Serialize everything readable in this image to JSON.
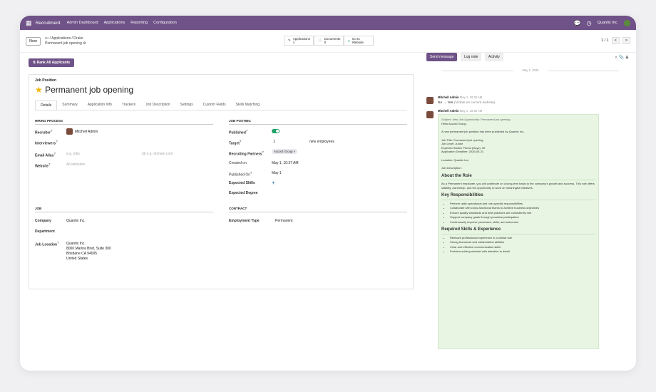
{
  "topbar": {
    "app_name": "Recruitment",
    "menus": [
      "Admin Dashboard",
      "Applications",
      "Reporting",
      "Configuration"
    ],
    "company": "Quantix Inc."
  },
  "subbar": {
    "new_label": "New",
    "breadcrumb": "••• / Applications / Drake",
    "current": "Permanent job opening",
    "smart_buttons": [
      {
        "label": "Applications",
        "count": "1"
      },
      {
        "label": "Documents",
        "count": "0"
      },
      {
        "label": "Go to",
        "count": "Website"
      }
    ],
    "pager": "1 / 1"
  },
  "form": {
    "rank_label": "Rank All Applicants",
    "job_position_label": "Job Position",
    "title": "Permanent job opening",
    "tabs": [
      "Details",
      "Summary",
      "Application Info",
      "Trackers",
      "Job Description",
      "Settings",
      "Custom Fields",
      "Skills Matching"
    ],
    "hiring_process": "HIRING PROCESS",
    "recruiter_label": "Recruiter",
    "recruiter": "Mitchell Admin",
    "interviewers_label": "Interviewers",
    "email_alias_label": "Email Alias",
    "email_ph": "e.g. jobs",
    "domain_ph": "@ e.g. domain.com",
    "website_label": "Website",
    "website_ph": "All websites",
    "job_posting": "JOB POSTING",
    "published_label": "Published",
    "target_label": "Target",
    "target": "1",
    "target_unit": "new employees",
    "partners_label": "Recruiting Partners",
    "partner_tag": "Accord Group ×",
    "created_label": "Created on",
    "created": "May 1, 10:37 AM",
    "published_on_label": "Published On",
    "published_on": "May 1",
    "skills_label": "Expected Skills",
    "degree_label": "Expected Degree",
    "job_section": "JOB",
    "company_label": "Company",
    "company": "Quantix Inc.",
    "department_label": "Department",
    "location_label": "Job Location",
    "location_lines": [
      "Quantix Inc.",
      "8000 Marina Blvd, Suite 300",
      "Brisbane CA 94005",
      "United States"
    ],
    "contract_section": "CONTRACT",
    "employment_label": "Employment Type",
    "employment": "Permanent"
  },
  "chatter": {
    "send_message": "Send message",
    "log_note": "Log note",
    "activity": "Activity",
    "date_sep": "May 1, 2026",
    "msg1_author": "Mitchell Admin",
    "msg1_time": "May 1, 10:38 AM",
    "msg1_change": "No → Yes",
    "msg1_note": "(Visible on current website)",
    "msg2_author": "Mitchell Admin",
    "msg2_time": "May 1, 10:38 AM",
    "note": {
      "subject": "Subject: New Job Opportunity: Permanent job opening",
      "hello": "Hello Accord Group,",
      "intro": "A new permanent job position has been published by Quantix Inc..",
      "job_title": "Job Title: Permanent job opening",
      "job_level": "Job Level: Junior",
      "notice": "Expected Notice Period (Days): 30",
      "deadline": "Application Deadline: 2026-05-21",
      "location": "Location: Quantix Inc.",
      "desc": "Job Description:",
      "about_h": "About the Role",
      "about": "As a Permanent employee, you will contribute on a long-term basis to the company's growth and success. This role offers stability, ownership, and the opportunity to work on meaningful initiatives.",
      "resp_h": "Key Responsibilities",
      "resp": [
        "Perform daily operational and role-specific responsibilities",
        "Collaborate with cross-functional teams to achieve business objectives",
        "Ensure quality standards and best practices are consistently met",
        "Support company goals through proactive participation",
        "Continuously improve processes, skills, and outcomes"
      ],
      "skills_h": "Required Skills & Experience",
      "skills": [
        "Relevant professional experience in a similar role",
        "Strong teamwork and collaboration abilities",
        "Clear and effective communication skills",
        "Problem-solving mindset with attention to detail"
      ]
    }
  }
}
